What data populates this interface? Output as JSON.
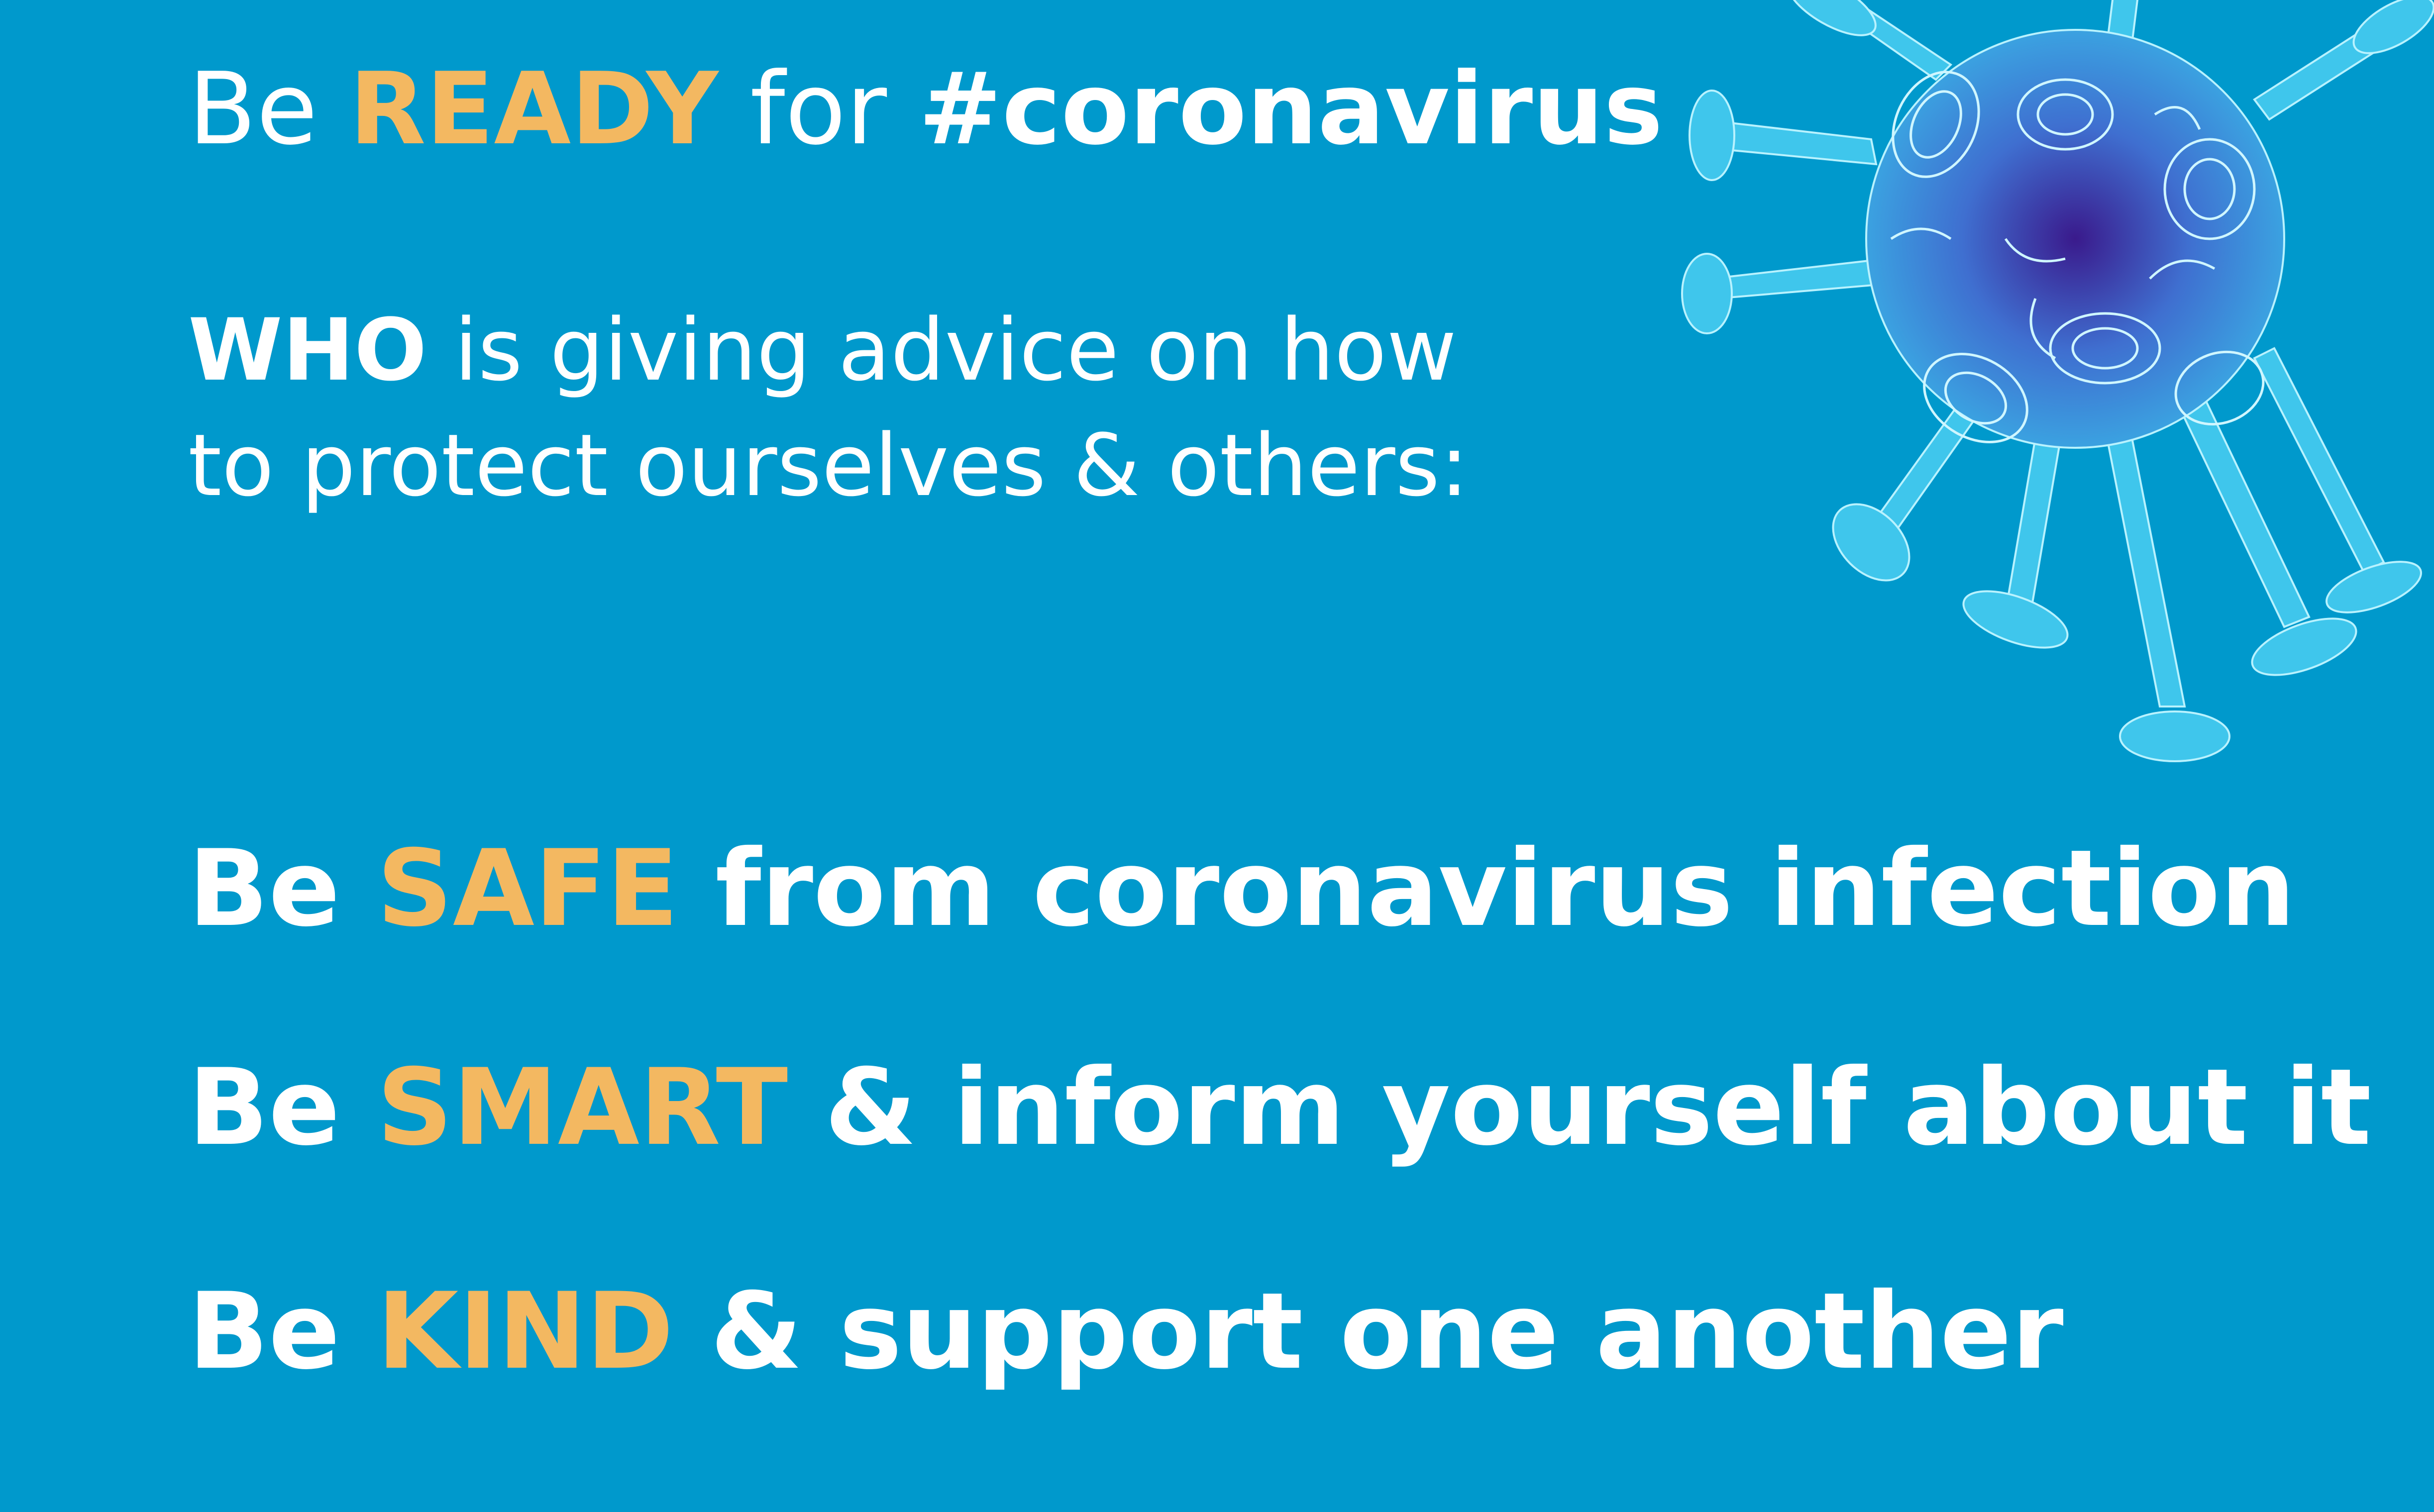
{
  "headline": {
    "prefix": "Be",
    "highlight": "READY",
    "middle": "for",
    "hashtag": "#coronavirus"
  },
  "intro": {
    "line1_bold": "WHO",
    "line1_rest": "is giving advice on how",
    "line2": "to protect ourselves & others:"
  },
  "tips": [
    {
      "prefix": "Be",
      "highlight": "SAFE",
      "rest": "from coronavirus infection"
    },
    {
      "prefix": "Be",
      "highlight": "SMART",
      "rest": "& inform yourself about it"
    },
    {
      "prefix": "Be",
      "highlight": "KIND",
      "rest": "& support one another"
    }
  ],
  "colors": {
    "background": "#0099CC",
    "accent": "#F3B861",
    "text": "#FFFFFF",
    "virus_core": "#3A1A8C",
    "virus_outline": "#7FE3F5"
  },
  "illustration": {
    "icon": "coronavirus-icon"
  }
}
